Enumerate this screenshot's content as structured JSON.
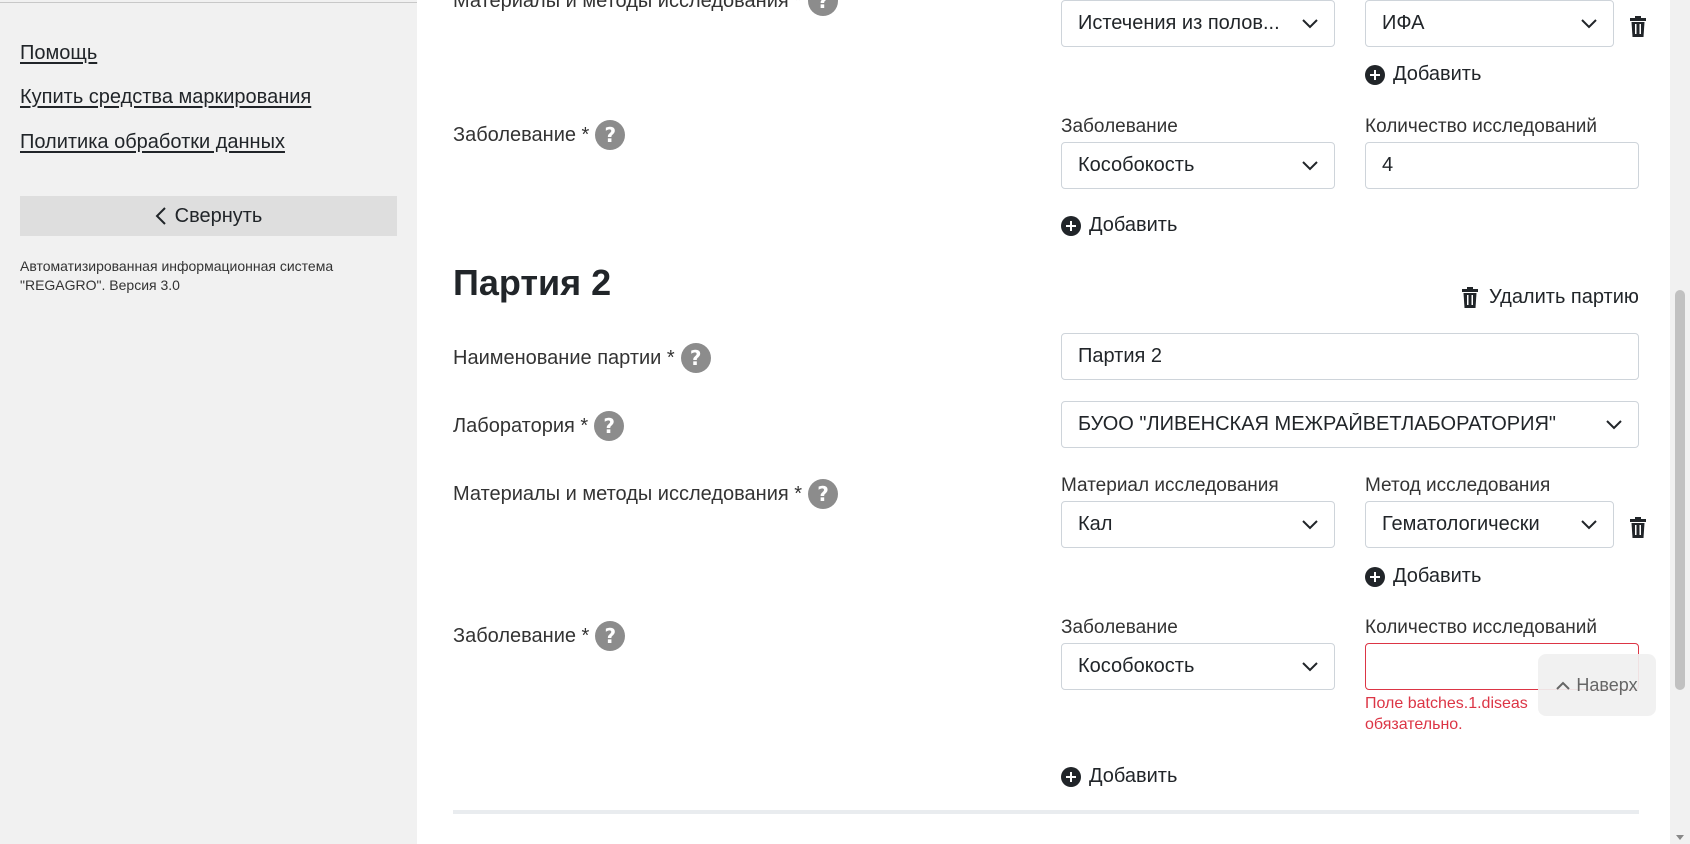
{
  "sidebar": {
    "links": [
      {
        "label": "Помощь"
      },
      {
        "label": "Купить средства маркирования"
      },
      {
        "label": "Политика обработки данных"
      }
    ],
    "collapse_label": "Свернуть",
    "system_info_line1": "Автоматизированная информационная система",
    "system_info_line2": "\"REGAGRO\". Версия 3.0"
  },
  "batch1": {
    "materials_label": "Материалы и методы исследования *",
    "material_value": "Истечения из полов...",
    "method_value": "ИФА",
    "add_method_label": "Добавить",
    "disease_label": "Заболевание *",
    "disease_caption": "Заболевание",
    "count_caption": "Количество исследований",
    "disease_value": "Кособокость",
    "count_value": "4",
    "add_disease_label": "Добавить"
  },
  "batch2": {
    "title": "Партия 2",
    "delete_label": "Удалить партию",
    "name_label": "Наименование партии *",
    "name_value": "Партия 2",
    "lab_label": "Лаборатория *",
    "lab_value": "БУОО \"ЛИВЕНСКАЯ МЕЖРАЙВЕТЛАБОРАТОРИЯ\"",
    "materials_label": "Материалы и методы исследования *",
    "material_caption": "Материал исследования",
    "method_caption": "Метод исследования",
    "material_value": "Кал",
    "method_value": "Гематологически",
    "add_method_label": "Добавить",
    "disease_label": "Заболевание *",
    "disease_caption": "Заболевание",
    "count_caption": "Количество исследований",
    "disease_value": "Кособокость",
    "count_value": "",
    "error_line1": "Поле batches.1.diseas",
    "error_line2": "обязательно.",
    "add_disease_label": "Добавить"
  },
  "help_glyph": "?",
  "to_top_label": "Наверх",
  "colors": {
    "error": "#dc3545",
    "sidebar_bg": "#f1f1f1",
    "help_icon": "#8c8c8c"
  }
}
